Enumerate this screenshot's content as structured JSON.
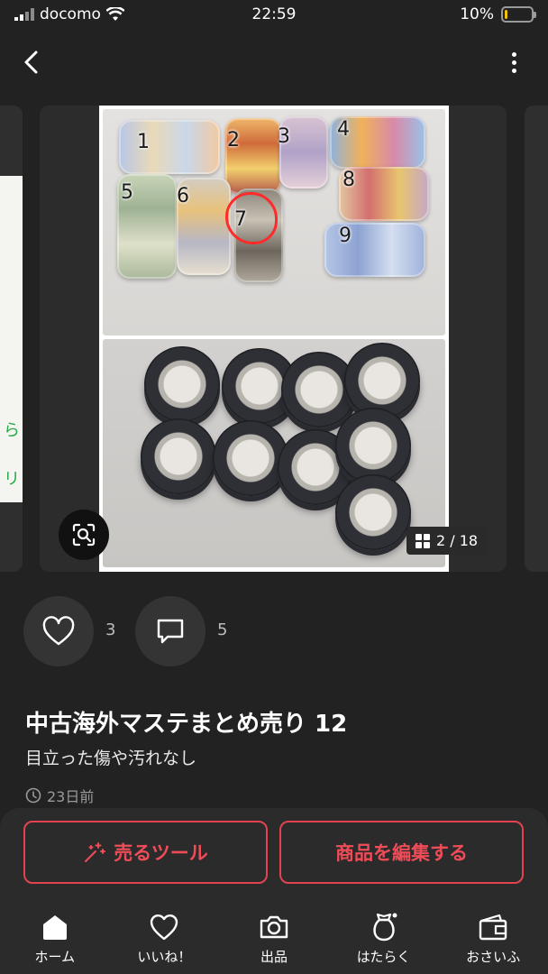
{
  "status_bar": {
    "carrier": "docomo",
    "time": "22:59",
    "battery": "10%",
    "battery_level": 0.1
  },
  "gallery": {
    "counter": "2 / 18",
    "top_numbers": [
      "1",
      "2",
      "3",
      "4",
      "5",
      "6",
      "7",
      "8",
      "9"
    ]
  },
  "reactions": {
    "likes": "3",
    "comments": "5"
  },
  "item": {
    "title": "中古海外マステまとめ売り 12",
    "condition": "目立った傷や汚れなし",
    "posted": "23日前"
  },
  "actions": {
    "sell_tool": "売るツール",
    "edit_item": "商品を編集する"
  },
  "tabs": [
    {
      "label": "ホーム",
      "icon": "home-icon"
    },
    {
      "label": "いいね！",
      "icon": "heart-icon"
    },
    {
      "label": "出品",
      "icon": "camera-icon"
    },
    {
      "label": "はたらく",
      "icon": "money-bag-icon"
    },
    {
      "label": "おさいふ",
      "icon": "wallet-icon"
    }
  ],
  "colors": {
    "accent": "#f04c58",
    "background": "#222222",
    "battery": "#f2c200"
  }
}
